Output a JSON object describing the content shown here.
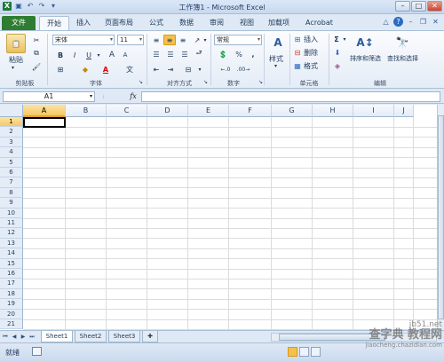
{
  "window": {
    "title": "工作簿1 - Microsoft Excel"
  },
  "quick_access": {
    "icons": [
      "excel-logo-icon",
      "save-icon",
      "undo-icon",
      "redo-icon",
      "customize-icon"
    ]
  },
  "tabs": [
    {
      "label": "文件"
    },
    {
      "label": "开始"
    },
    {
      "label": "插入"
    },
    {
      "label": "页面布局"
    },
    {
      "label": "公式"
    },
    {
      "label": "数据"
    },
    {
      "label": "审阅"
    },
    {
      "label": "视图"
    },
    {
      "label": "加载项"
    },
    {
      "label": "Acrobat"
    }
  ],
  "ribbon": {
    "clipboard": {
      "paste_label": "粘贴",
      "group_label": "剪贴板"
    },
    "font": {
      "name": "宋体",
      "size": "11",
      "group_label": "字体",
      "bold": "B",
      "italic": "I",
      "underline": "U",
      "grow": "A",
      "shrink": "A"
    },
    "alignment": {
      "group_label": "对齐方式"
    },
    "number": {
      "format": "常规",
      "group_label": "数字",
      "percent": "%",
      "comma": ","
    },
    "styles": {
      "label": "样式"
    },
    "cells": {
      "insert": "插入",
      "delete": "删除",
      "format": "格式",
      "group_label": "单元格"
    },
    "editing": {
      "sigma": "Σ",
      "sort_filter": "排序和筛选",
      "find_select": "查找和选择",
      "group_label": "编辑"
    }
  },
  "formula_bar": {
    "name_box": "A1",
    "fx": "fx",
    "formula": ""
  },
  "grid": {
    "columns": [
      "A",
      "B",
      "C",
      "D",
      "E",
      "F",
      "G",
      "H",
      "I",
      "J"
    ],
    "rows": [
      "1",
      "2",
      "3",
      "4",
      "5",
      "6",
      "7",
      "8",
      "9",
      "10",
      "11",
      "12",
      "13",
      "14",
      "15",
      "16",
      "17",
      "18",
      "19",
      "20",
      "21"
    ],
    "selected_cell": "A1"
  },
  "sheets": [
    {
      "label": "Sheet1"
    },
    {
      "label": "Sheet2"
    },
    {
      "label": "Sheet3"
    }
  ],
  "status": {
    "ready": "就绪"
  },
  "watermark": {
    "line1": "查字典 教程网",
    "line2": "jiaocheng.chazidian.com",
    "site": "jb51.net"
  }
}
